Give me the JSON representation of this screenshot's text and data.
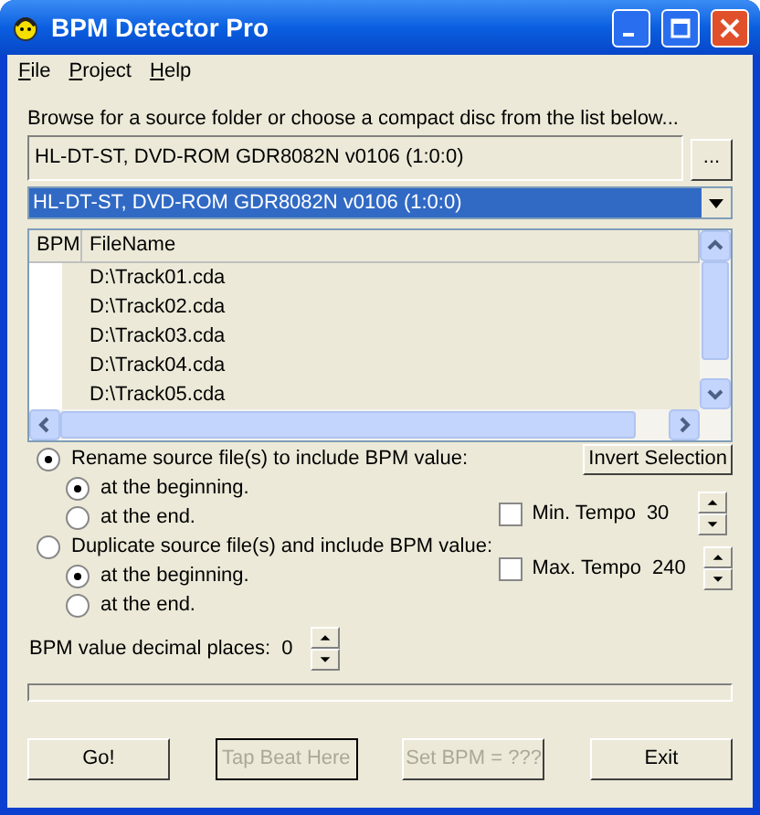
{
  "window": {
    "title": "BPM Detector Pro"
  },
  "menu": [
    {
      "label": "File"
    },
    {
      "label": "Project"
    },
    {
      "label": "Help"
    }
  ],
  "source": {
    "label": "Browse for a source folder or choose a compact disc from the list below...",
    "value": "HL-DT-ST, DVD-ROM GDR8082N v0106 (1:0:0)",
    "browse_button": "..."
  },
  "drive_combo": {
    "value": "HL-DT-ST, DVD-ROM GDR8082N v0106 (1:0:0)",
    "selected": true
  },
  "file_list": {
    "columns": [
      "BPM",
      "FileName"
    ],
    "rows": [
      {
        "filename": "D:\\Track01.cda"
      },
      {
        "filename": "D:\\Track02.cda"
      },
      {
        "filename": "D:\\Track03.cda"
      },
      {
        "filename": "D:\\Track04.cda"
      },
      {
        "filename": "D:\\Track05.cda"
      }
    ]
  },
  "options": [
    {
      "label": "Rename source file(s) to include BPM value:",
      "selected": true,
      "children": [
        {
          "label": "at the beginning.",
          "selected": true
        },
        {
          "label": "at the end.",
          "selected": false
        }
      ]
    },
    {
      "label": "Duplicate source file(s) and include BPM value:",
      "selected": false,
      "children": [
        {
          "label": "at the beginning.",
          "selected": true
        },
        {
          "label": "at the end.",
          "selected": false
        }
      ]
    }
  ],
  "invert_button": "Invert Selection",
  "tempos": [
    {
      "label": "Min. Tempo",
      "value": "30",
      "checked": false
    },
    {
      "label": "Max. Tempo",
      "value": "240",
      "checked": false
    }
  ],
  "decimal_places": {
    "label": "BPM value decimal places:",
    "value": "0"
  },
  "buttons": [
    {
      "label": "Go!",
      "disabled": false,
      "focused": false
    },
    {
      "label": "Tap Beat Here",
      "disabled": true,
      "focused": true
    },
    {
      "label": "Set BPM = ???",
      "disabled": true,
      "focused": false
    },
    {
      "label": "Exit",
      "disabled": false,
      "focused": false
    }
  ]
}
